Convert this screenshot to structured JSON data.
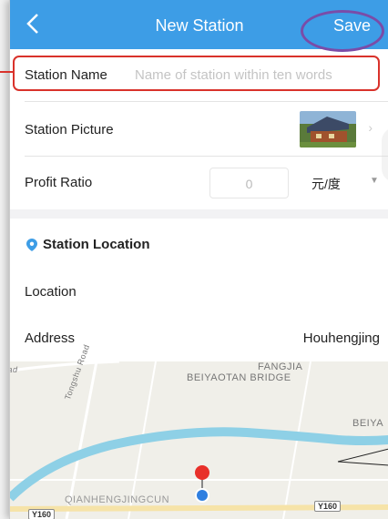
{
  "navbar": {
    "back_icon": "chevron-left-icon",
    "title": "New Station",
    "save_label": "Save"
  },
  "form": {
    "station_name": {
      "label": "Station Name",
      "value": "",
      "placeholder": "Name of station within ten words"
    },
    "station_picture": {
      "label": "Station Picture"
    },
    "profit_ratio": {
      "label": "Profit Ratio",
      "value": "0",
      "unit": "元/度"
    },
    "location_section": {
      "icon": "location-pin-icon",
      "title": "Station Location"
    },
    "location": {
      "label": "Location"
    },
    "address": {
      "label": "Address",
      "value": "Houhengjing"
    }
  },
  "map": {
    "labels": [
      "FANGJIA",
      "BEIYAOTAN BRIDGE",
      "BEIYA",
      "QIANHENGJINGCUN",
      "Tongshu Road",
      "oad"
    ],
    "road_badges": [
      "Y160",
      "Y160"
    ]
  },
  "colors": {
    "accent": "#3d9de6",
    "highlight": "#d9322b",
    "save_ring": "#7a4ca8",
    "marker_red": "#e8302a",
    "marker_blue": "#2f7fe0"
  }
}
